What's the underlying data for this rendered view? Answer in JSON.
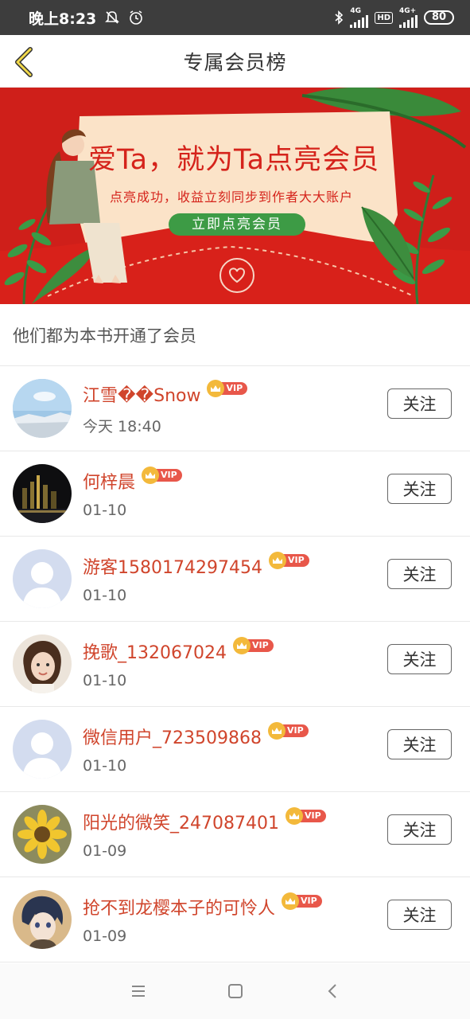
{
  "status_bar": {
    "time": "晚上8:23",
    "network_1": "4G",
    "network_2": "4G+",
    "hd": "HD",
    "battery": "80"
  },
  "header": {
    "title": "专属会员榜"
  },
  "banner": {
    "headline": "爱Ta，就为Ta点亮会员",
    "subline": "点亮成功，收益立刻同步到作者大大账户",
    "cta": "立即点亮会员"
  },
  "section": {
    "title": "他们都为本书开通了会员"
  },
  "vip_label": "VIP",
  "follow_label": "关注",
  "members": [
    {
      "name": "江雪��Snow",
      "date": "今天 18:40",
      "avatar": "snow-landscape"
    },
    {
      "name": "何梓晨",
      "date": "01-10",
      "avatar": "city-night"
    },
    {
      "name": "游客1580174297454",
      "date": "01-10",
      "avatar": "default"
    },
    {
      "name": "挽歌_132067024",
      "date": "01-10",
      "avatar": "girl-photo"
    },
    {
      "name": "微信用户_723509868",
      "date": "01-10",
      "avatar": "default"
    },
    {
      "name": "阳光的微笑_247087401",
      "date": "01-09",
      "avatar": "sunflower"
    },
    {
      "name": "抢不到龙樱本子的可怜人",
      "date": "01-09",
      "avatar": "anime-boy"
    }
  ],
  "colors": {
    "accent_red": "#d0452c",
    "banner_red": "#cf1f1a",
    "vip_gold": "#f3b93b",
    "cta_green": "#3d9b45"
  }
}
